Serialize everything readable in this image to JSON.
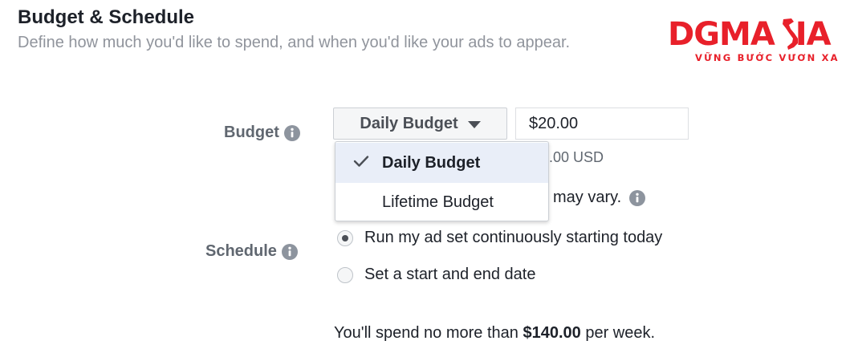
{
  "header": {
    "title": "Budget & Schedule",
    "subtitle": "Define how much you'd like to spend, and when you'd like your ads to appear."
  },
  "logo": {
    "main": "DGMAsIA",
    "tagline": "VỮNG BƯỚC VƯƠN XA",
    "color": "#e8202a"
  },
  "budget": {
    "label": "Budget",
    "info_icon": "info-icon",
    "dropdown_label": "Daily Budget",
    "amount_value": "$20.00",
    "usd_fragment": ".00 USD",
    "vary_fragment": "may vary.",
    "menu": {
      "options": [
        {
          "label": "Daily Budget",
          "selected": true
        },
        {
          "label": "Lifetime Budget",
          "selected": false
        }
      ]
    }
  },
  "schedule": {
    "label": "Schedule",
    "info_icon": "info-icon",
    "options": [
      {
        "label": "Run my ad set continuously starting today",
        "checked": true
      },
      {
        "label": "Set a start and end date",
        "checked": false
      }
    ]
  },
  "summary": {
    "prefix": "You'll spend no more than ",
    "amount": "$140.00",
    "suffix": " per week."
  },
  "colors": {
    "text": "#1d2129",
    "muted": "#90949c",
    "label": "#606770",
    "selected_bg": "#e9eef8",
    "button_bg": "#f5f6f7"
  }
}
